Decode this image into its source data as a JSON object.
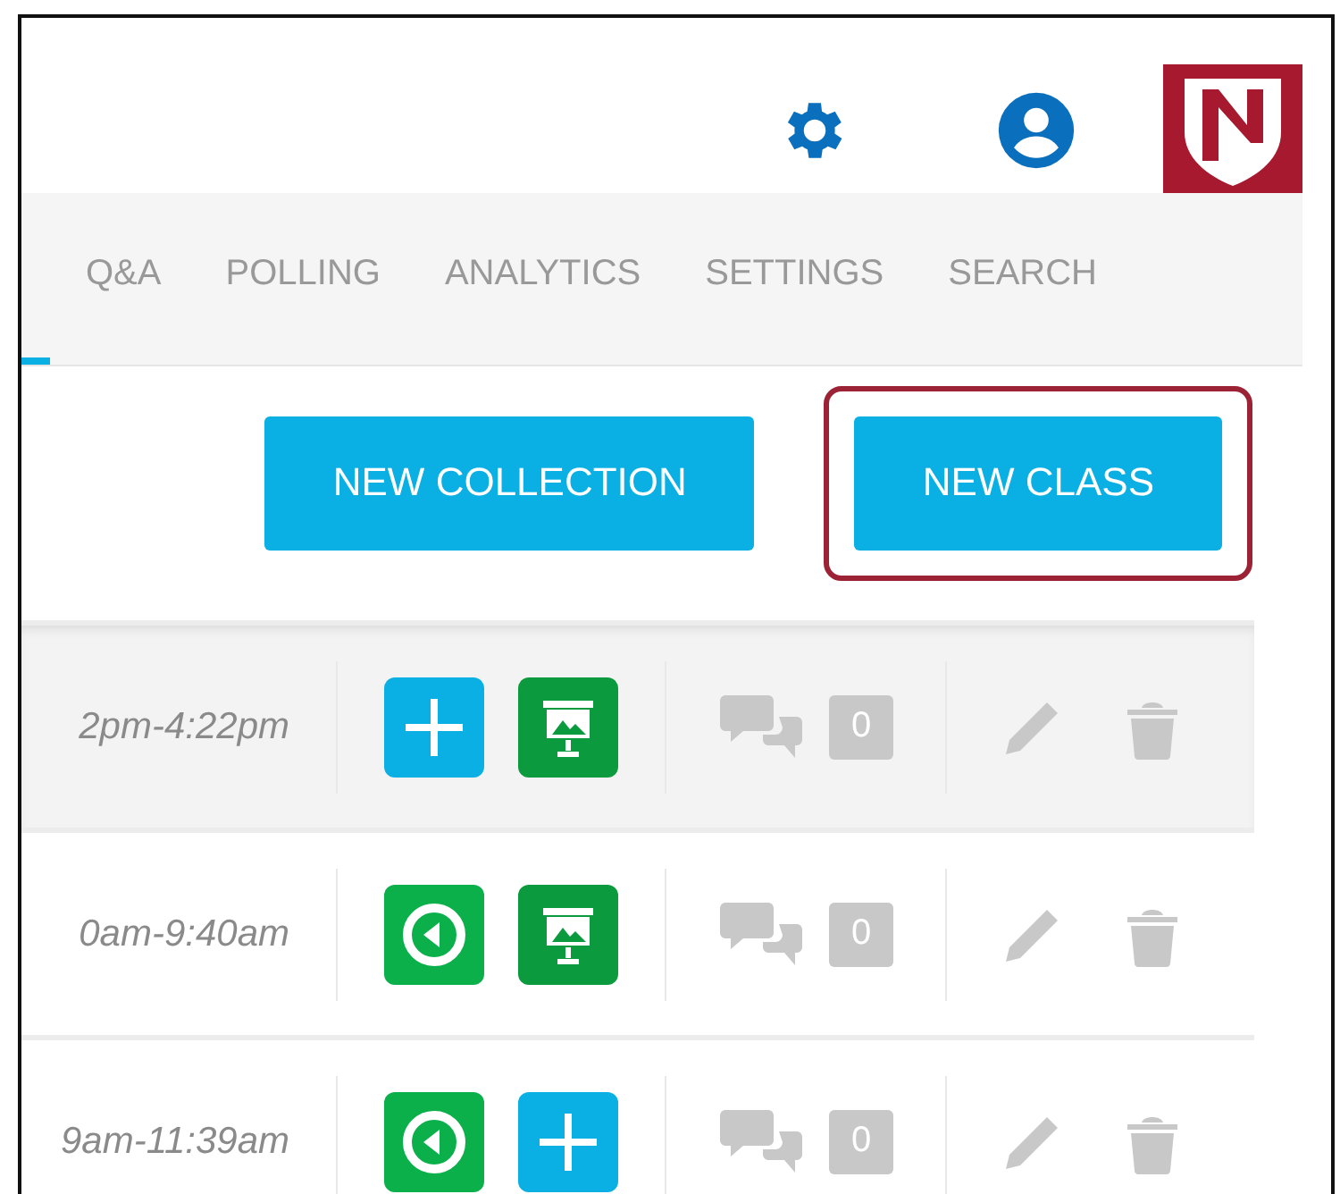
{
  "nav": {
    "tabs": [
      {
        "label": "Q&A",
        "selected": false
      },
      {
        "label": "POLLING",
        "selected": false
      },
      {
        "label": "ANALYTICS",
        "selected": false
      },
      {
        "label": "SETTINGS",
        "selected": false
      },
      {
        "label": "SEARCH",
        "selected": false
      }
    ]
  },
  "buttons": [
    {
      "label": "NEW COLLECTION",
      "outlined": false
    },
    {
      "label": "NEW CLASS",
      "outlined": true
    }
  ],
  "rows": [
    {
      "time": "2pm-4:22pm",
      "highlighted": true,
      "actions": [
        {
          "kind": "add"
        },
        {
          "kind": "present"
        }
      ],
      "count": "0"
    },
    {
      "time": "0am-9:40am",
      "highlighted": false,
      "actions": [
        {
          "kind": "start"
        },
        {
          "kind": "present"
        }
      ],
      "count": "0"
    },
    {
      "time": "9am-11:39am",
      "highlighted": false,
      "actions": [
        {
          "kind": "start"
        },
        {
          "kind": "add"
        }
      ],
      "count": "0"
    }
  ]
}
